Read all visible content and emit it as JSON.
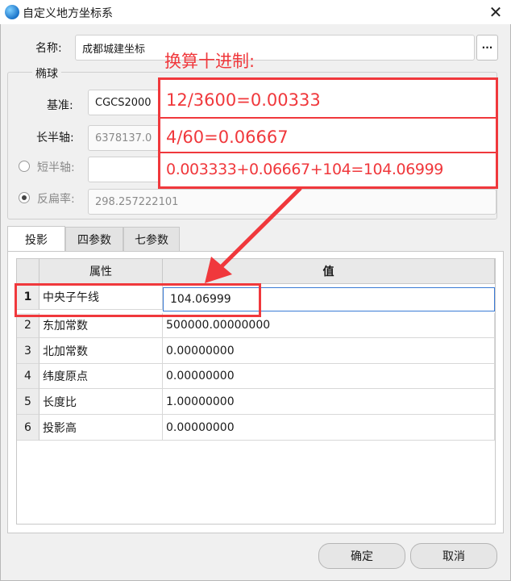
{
  "window": {
    "title": "自定义地方坐标系"
  },
  "name_row": {
    "label": "名称:",
    "value": "成都城建坐标",
    "browse_label": "···"
  },
  "ellipsoid": {
    "group_label": "椭球",
    "datum_label": "基准:",
    "datum_value": "CGCS2000",
    "semi_major_label": "长半轴:",
    "semi_major_value": "6378137.0",
    "semi_minor_label": "短半轴:",
    "semi_minor_value": "",
    "flattening_label": "反扁率:",
    "flattening_value": "298.257222101"
  },
  "tabs": [
    {
      "label": "投影",
      "active": true
    },
    {
      "label": "四参数",
      "active": false
    },
    {
      "label": "七参数",
      "active": false
    }
  ],
  "grid": {
    "headers": {
      "property": "属性",
      "value": "值"
    },
    "rows": [
      {
        "num": "1",
        "property": "中央子午线",
        "value": "104.06999"
      },
      {
        "num": "2",
        "property": "东加常数",
        "value": "500000.00000000"
      },
      {
        "num": "3",
        "property": "北加常数",
        "value": "0.00000000"
      },
      {
        "num": "4",
        "property": "纬度原点",
        "value": "0.00000000"
      },
      {
        "num": "5",
        "property": "长度比",
        "value": "1.00000000"
      },
      {
        "num": "6",
        "property": "投影高",
        "value": "0.00000000"
      }
    ]
  },
  "buttons": {
    "ok": "确定",
    "cancel": "取消"
  },
  "annotations": {
    "heading": "换算十进制:",
    "line1": "12/3600=0.00333",
    "line2": "4/60=0.06667",
    "line3": "0.003333+0.06667+104=104.06999",
    "color": "#f0383c"
  },
  "icons": {
    "close": "close-icon",
    "app": "app-globe-icon",
    "dropdown": "chevron-down-icon"
  }
}
